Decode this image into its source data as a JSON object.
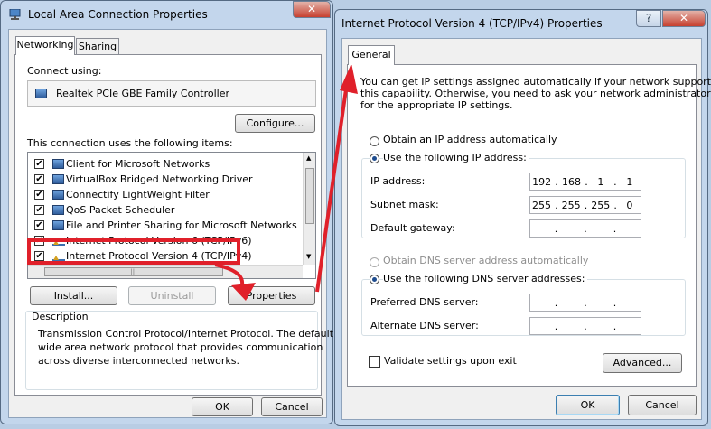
{
  "left_window": {
    "title": "Local Area Connection Properties",
    "close_glyph": "✕",
    "tabs": [
      "Networking",
      "Sharing"
    ],
    "connect_using_label": "Connect using:",
    "adapter_name": "Realtek PCIe GBE Family Controller",
    "configure_label": "Configure...",
    "items_label": "This connection uses the following items:",
    "items": [
      {
        "label": "Client for Microsoft Networks",
        "checked": true
      },
      {
        "label": "VirtualBox Bridged Networking Driver",
        "checked": true
      },
      {
        "label": "Connectify LightWeight Filter",
        "checked": true
      },
      {
        "label": "QoS Packet Scheduler",
        "checked": true
      },
      {
        "label": "File and Printer Sharing for Microsoft Networks",
        "checked": true
      },
      {
        "label": "Internet Protocol Version 6 (TCP/IPv6)",
        "checked": true
      },
      {
        "label": "Internet Protocol Version 4 (TCP/IPv4)",
        "checked": true
      }
    ],
    "install_label": "Install...",
    "uninstall_label": "Uninstall",
    "properties_label": "Properties",
    "description_title": "Description",
    "description_text_1": "Transmission Control Protocol/Internet Protocol. The default",
    "description_text_2": "wide area network protocol that provides communication",
    "description_text_3": "across diverse interconnected networks.",
    "ok_label": "OK",
    "cancel_label": "Cancel"
  },
  "right_window": {
    "title": "Internet Protocol Version 4 (TCP/IPv4) Properties",
    "help_glyph": "?",
    "close_glyph": "✕",
    "tab_general": "General",
    "intro_1": "You can get IP settings assigned automatically if your network supports",
    "intro_2": "this capability. Otherwise, you need to ask your network administrator",
    "intro_3": "for the appropriate IP settings.",
    "obtain_ip_auto": "Obtain an IP address automatically",
    "use_following_ip": "Use the following IP address:",
    "ip_address_label": "IP address:",
    "subnet_mask_label": "Subnet mask:",
    "default_gateway_label": "Default gateway:",
    "ip_address": [
      "192",
      "168",
      "1",
      "1"
    ],
    "subnet_mask": [
      "255",
      "255",
      "255",
      "0"
    ],
    "default_gateway": [
      "",
      "",
      "",
      ""
    ],
    "obtain_dns_auto": "Obtain DNS server address automatically",
    "use_following_dns": "Use the following DNS server addresses:",
    "preferred_dns_label": "Preferred DNS server:",
    "alternate_dns_label": "Alternate DNS server:",
    "preferred_dns": [
      "",
      "",
      "",
      ""
    ],
    "alternate_dns": [
      "",
      "",
      "",
      ""
    ],
    "validate_label": "Validate settings upon exit",
    "advanced_label": "Advanced...",
    "ok_label": "OK",
    "cancel_label": "Cancel"
  },
  "colors": {
    "annotation_red": "#e0202a",
    "close_button_red": "#c7402f"
  }
}
